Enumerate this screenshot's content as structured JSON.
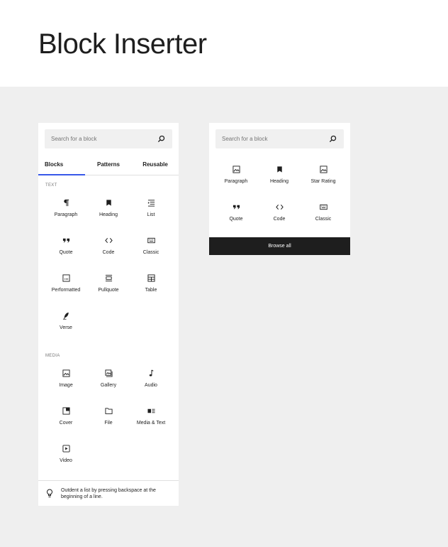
{
  "page": {
    "title": "Block Inserter"
  },
  "panel1": {
    "search_placeholder": "Search for a block",
    "tabs": [
      {
        "label": "Blocks",
        "active": true
      },
      {
        "label": "Patterns",
        "active": false
      },
      {
        "label": "Reusable",
        "active": false
      }
    ],
    "sections": [
      {
        "label": "TEXT",
        "blocks": [
          {
            "label": "Paragraph",
            "icon": "paragraph-icon"
          },
          {
            "label": "Heading",
            "icon": "heading-icon"
          },
          {
            "label": "List",
            "icon": "list-icon"
          },
          {
            "label": "Quote",
            "icon": "quote-icon"
          },
          {
            "label": "Code",
            "icon": "code-icon"
          },
          {
            "label": "Classic",
            "icon": "classic-icon"
          },
          {
            "label": "Performatted",
            "icon": "preformatted-icon"
          },
          {
            "label": "Pullquote",
            "icon": "pullquote-icon"
          },
          {
            "label": "Table",
            "icon": "table-icon"
          },
          {
            "label": "Verse",
            "icon": "verse-icon"
          }
        ]
      },
      {
        "label": "MEDIA",
        "blocks": [
          {
            "label": "Image",
            "icon": "image-icon"
          },
          {
            "label": "Gallery",
            "icon": "gallery-icon"
          },
          {
            "label": "Audio",
            "icon": "audio-icon"
          },
          {
            "label": "Cover",
            "icon": "cover-icon"
          },
          {
            "label": "File",
            "icon": "file-icon"
          },
          {
            "label": "Media & Text",
            "icon": "media-text-icon"
          },
          {
            "label": "Video",
            "icon": "video-icon"
          }
        ]
      }
    ],
    "tip": "Outdent a list by pressing backspace at the beginning of a line."
  },
  "panel2": {
    "search_placeholder": "Search for a block",
    "blocks": [
      {
        "label": "Paragraph",
        "icon": "image-icon"
      },
      {
        "label": "Heading",
        "icon": "heading-icon"
      },
      {
        "label": "Star Rating",
        "icon": "image-icon"
      },
      {
        "label": "Quote",
        "icon": "quote-icon"
      },
      {
        "label": "Code",
        "icon": "code-icon"
      },
      {
        "label": "Classic",
        "icon": "classic-icon"
      }
    ],
    "browse_label": "Browse all"
  },
  "colors": {
    "accent": "#3858e9",
    "canvas": "#efefef",
    "dark": "#1e1e1e"
  }
}
